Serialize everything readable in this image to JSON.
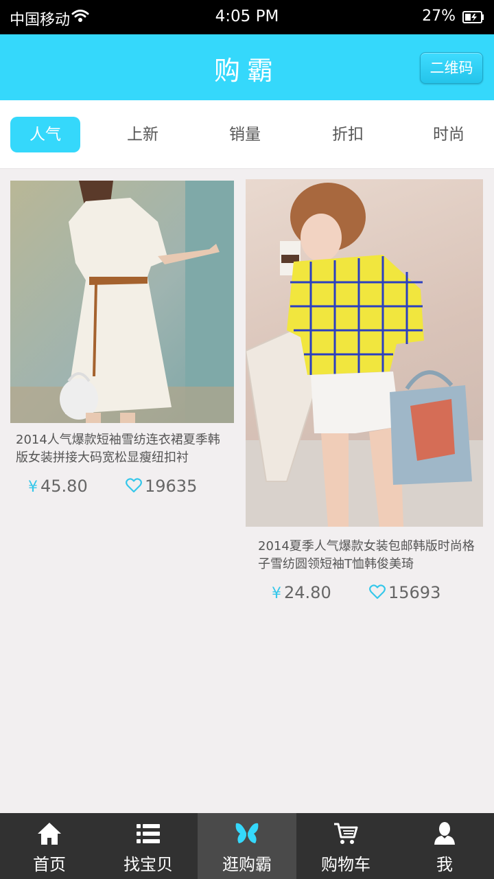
{
  "status_bar": {
    "carrier": "中国移动",
    "time": "4:05 PM",
    "battery": "27%"
  },
  "header": {
    "title": "购霸",
    "qr_button": "二维码"
  },
  "tabs": [
    {
      "label": "人气",
      "active": true
    },
    {
      "label": "上新",
      "active": false
    },
    {
      "label": "销量",
      "active": false
    },
    {
      "label": "折扣",
      "active": false
    },
    {
      "label": "时尚",
      "active": false
    }
  ],
  "products": [
    {
      "description": "2014人气爆款短袖雪纺连衣裙夏季韩版女装拼接大码宽松显瘦纽扣衬",
      "currency": "¥",
      "price": "45.80",
      "likes": "19635"
    },
    {
      "description": "2014夏季人气爆款女装包邮韩版时尚格子雪纺圆领短袖T恤韩俊美琦",
      "currency": "¥",
      "price": "24.80",
      "likes": "15693"
    }
  ],
  "bottom_nav": [
    {
      "label": "首页",
      "icon": "home-icon",
      "active": false
    },
    {
      "label": "找宝贝",
      "icon": "list-icon",
      "active": false
    },
    {
      "label": "逛购霸",
      "icon": "butterfly-icon",
      "active": true
    },
    {
      "label": "购物车",
      "icon": "cart-icon",
      "active": false
    },
    {
      "label": "我",
      "icon": "user-icon",
      "active": false
    }
  ],
  "colors": {
    "accent": "#35d8fb",
    "nav_bg": "#313131",
    "page_bg": "#f2eff0"
  }
}
